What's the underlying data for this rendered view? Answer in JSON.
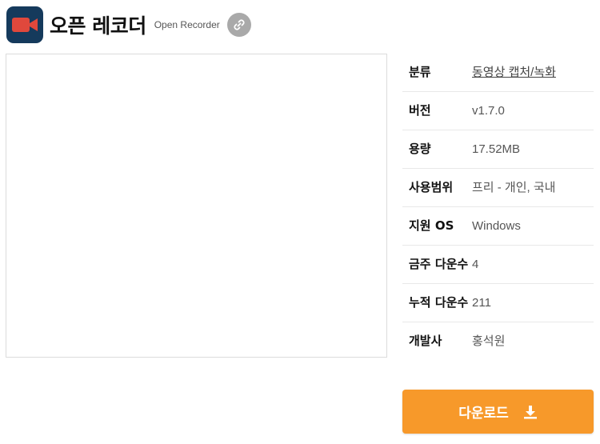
{
  "header": {
    "title": "오픈 레코더",
    "subtitle": "Open Recorder",
    "app_icon": "video-camera-icon",
    "link_icon": "link-icon"
  },
  "colors": {
    "app_icon_bg": "#153a5c",
    "camera": "#e0483c",
    "download_button": "#f7992a",
    "link_button": "#a9a9a9"
  },
  "info": [
    {
      "label": "분류",
      "value": "동영상 캡처/녹화",
      "link": true
    },
    {
      "label": "버전",
      "value": "v1.7.0",
      "link": false
    },
    {
      "label": "용량",
      "value": "17.52MB",
      "link": false
    },
    {
      "label": "사용범위",
      "value": "프리 - 개인, 국내",
      "link": false
    },
    {
      "label": "지원 OS",
      "value": "Windows",
      "link": false
    },
    {
      "label": "금주 다운수",
      "value": "4",
      "link": false
    },
    {
      "label": "누적 다운수",
      "value": "211",
      "link": false
    },
    {
      "label": "개발사",
      "value": "홍석원",
      "link": false
    }
  ],
  "download": {
    "label": "다운로드",
    "icon": "download-icon"
  }
}
